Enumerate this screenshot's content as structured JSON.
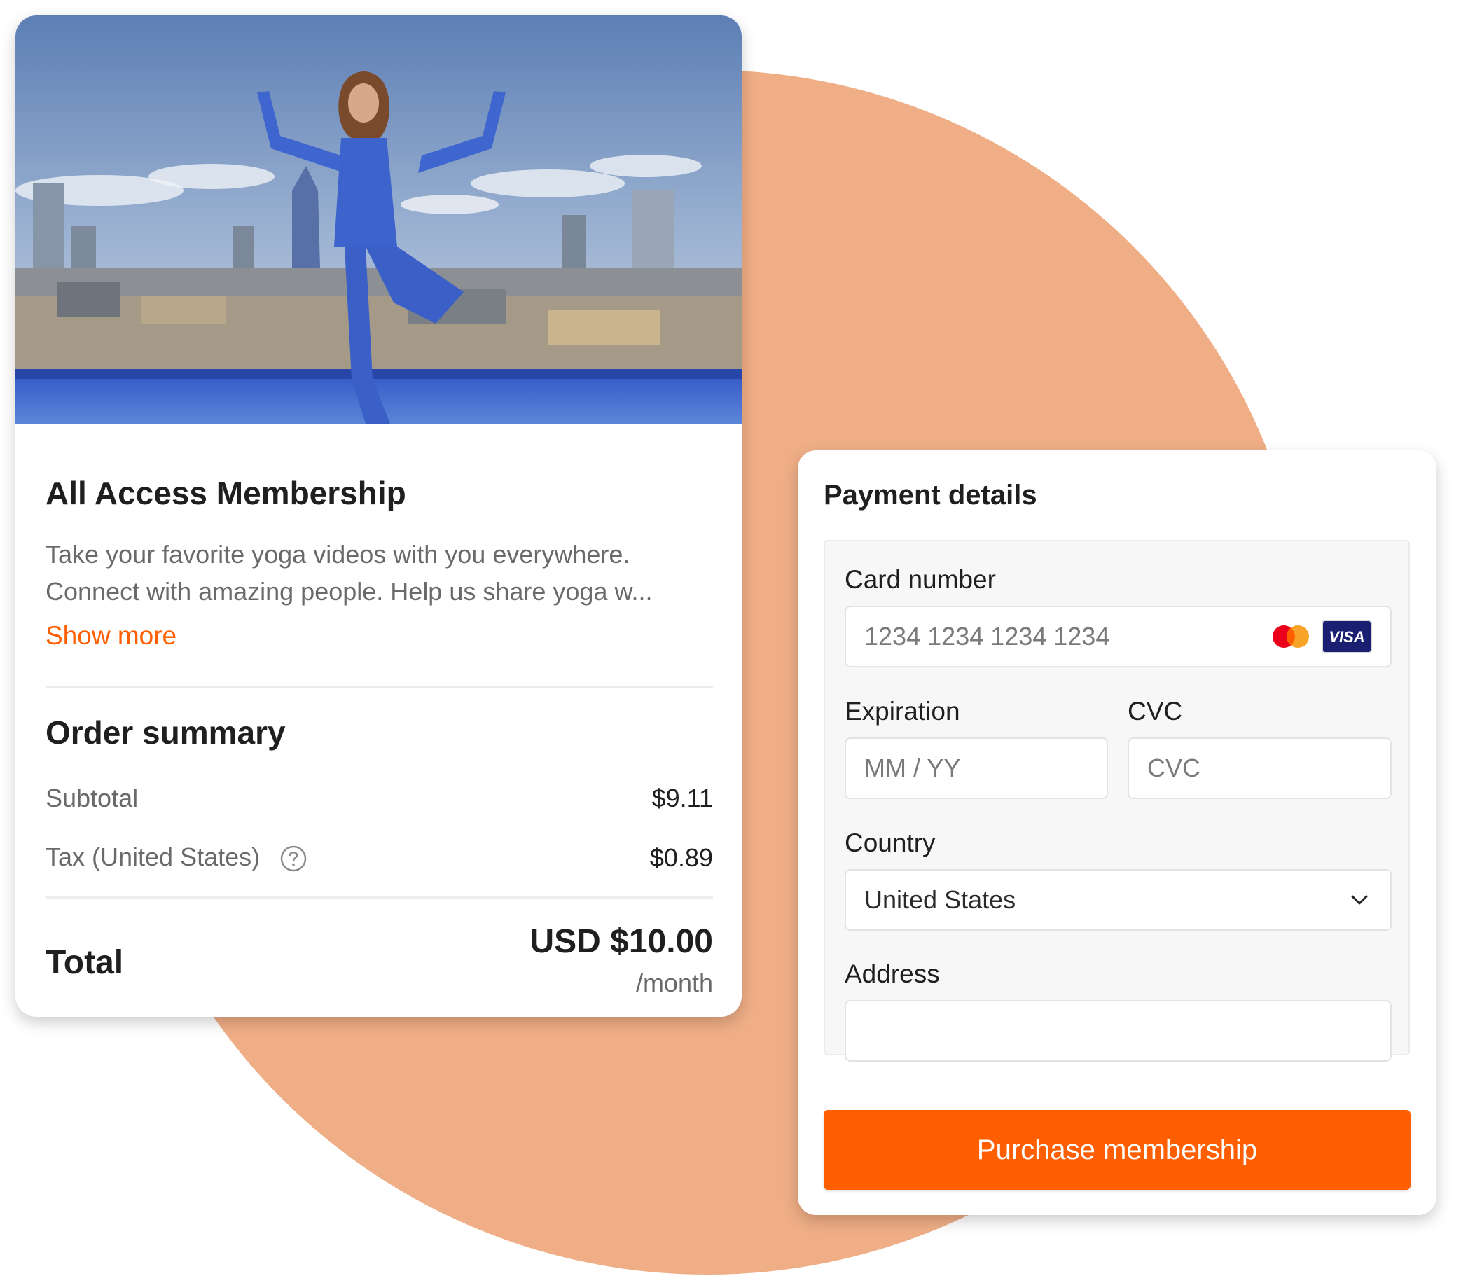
{
  "colors": {
    "accent": "#ff5f00",
    "background_circle": "#efae86",
    "muted_text": "#6a6a6a"
  },
  "membership": {
    "image_alt": "Woman in blue outfit doing a yoga tree pose on a rooftop above a city skyline",
    "title": "All Access Membership",
    "description_line1": "Take your favorite yoga videos with you everywhere.",
    "description_line2": "Connect with amazing people. Help us share yoga w...",
    "show_more_label": "Show more"
  },
  "order_summary": {
    "title": "Order summary",
    "subtotal_label": "Subtotal",
    "subtotal_value": "$9.11",
    "tax_label": "Tax (United States)",
    "tax_value": "$0.89",
    "help_icon": "question-circle-icon",
    "total_label": "Total",
    "total_value": "USD $10.00",
    "total_period": "/month"
  },
  "payment": {
    "title": "Payment details",
    "card_number_label": "Card number",
    "card_number_placeholder": "1234 1234 1234 1234",
    "card_brands": [
      "mastercard-icon",
      "visa-icon"
    ],
    "visa_text": "VISA",
    "expiration_label": "Expiration",
    "expiration_placeholder": "MM / YY",
    "cvc_label": "CVC",
    "cvc_placeholder": "CVC",
    "country_label": "Country",
    "country_value": "United States",
    "address_label": "Address",
    "address_value": "",
    "purchase_button_label": "Purchase membership"
  }
}
